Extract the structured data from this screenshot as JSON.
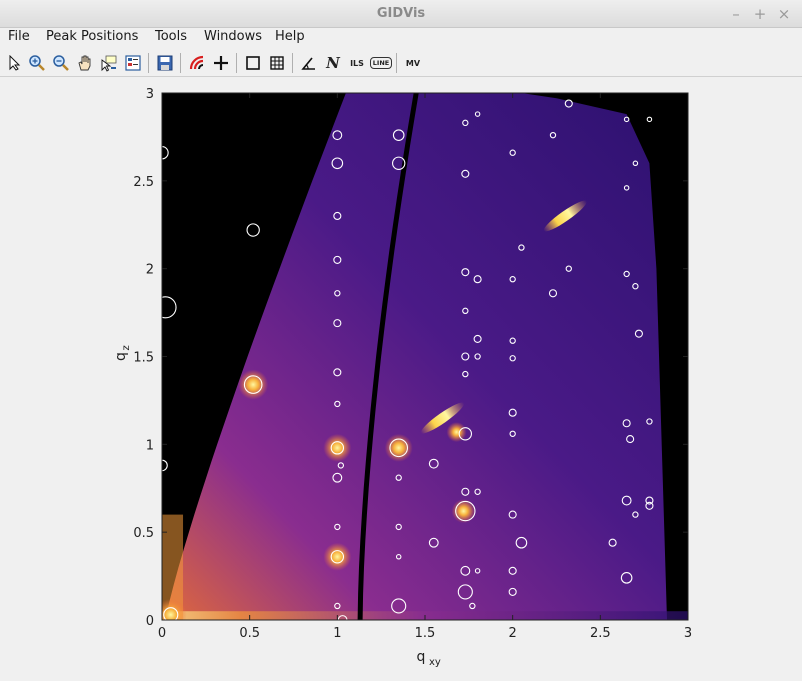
{
  "window": {
    "title": "GIDVis",
    "minimize": "–",
    "maximize": "+",
    "close": "×"
  },
  "menu": [
    "File",
    "Peak Positions",
    "Tools",
    "Windows",
    "Help"
  ],
  "toolbar": [
    {
      "name": "select-tool",
      "icon": "pointer-icon"
    },
    {
      "name": "zoom-in-tool",
      "icon": "zoom-in-icon"
    },
    {
      "name": "zoom-out-tool",
      "icon": "zoom-out-icon"
    },
    {
      "name": "pan-tool",
      "icon": "hand-icon"
    },
    {
      "name": "data-cursor-tool",
      "icon": "data-cursor-icon"
    },
    {
      "name": "legend-tool",
      "icon": "legend-icon"
    },
    {
      "name": "save-tool",
      "icon": "save-icon"
    },
    {
      "name": "ring-tool",
      "icon": "arc-icon"
    },
    {
      "name": "crosshair-tool",
      "icon": "plus-icon"
    },
    {
      "name": "box-tool",
      "icon": "square-icon"
    },
    {
      "name": "grid-tool",
      "icon": "grid-icon"
    },
    {
      "name": "angle-tool",
      "icon": "angle-icon"
    },
    {
      "name": "n-tool",
      "icon": "n-icon",
      "label": "N"
    },
    {
      "name": "ils-tool",
      "icon": "ils-icon",
      "label": "ILS"
    },
    {
      "name": "line-tool",
      "icon": "line-icon",
      "label": "LINE"
    },
    {
      "name": "mv-tool",
      "icon": "mv-icon",
      "label": "MV"
    }
  ],
  "chart_data": {
    "type": "heatmap",
    "xlabel": "q",
    "xlabel_sub": "xy",
    "ylabel": "q",
    "ylabel_sub": "z",
    "xlim": [
      0,
      3
    ],
    "ylim": [
      0,
      3
    ],
    "xticks": [
      "0",
      "0.5",
      "1",
      "1.5",
      "2",
      "2.5",
      "3"
    ],
    "yticks": [
      "0",
      "0.5",
      "1",
      "1.5",
      "2",
      "2.5",
      "3"
    ],
    "colormap": "plasma",
    "colors": {
      "background": "#000000",
      "low": "#2d1170",
      "mid": "#8a2d8f",
      "high": "#e16a3a",
      "peak": "#fff7a0"
    },
    "bright_spots": [
      {
        "x": 0.52,
        "y": 1.34,
        "i": 0.9
      },
      {
        "x": 1.0,
        "y": 0.98,
        "i": 0.8
      },
      {
        "x": 1.0,
        "y": 0.36,
        "i": 0.8
      },
      {
        "x": 1.35,
        "y": 0.98,
        "i": 0.8
      },
      {
        "x": 1.72,
        "y": 0.62,
        "i": 0.6
      },
      {
        "x": 1.68,
        "y": 1.07,
        "i": 0.4
      },
      {
        "x": 0.05,
        "y": 0.03,
        "i": 1.0
      }
    ],
    "streaks": [
      {
        "x": 2.3,
        "y": 2.3,
        "angle": -35
      },
      {
        "x": 1.6,
        "y": 1.15,
        "angle": -35
      }
    ],
    "peak_circles": [
      {
        "x": 0.0,
        "y": 2.66,
        "r": 0.035
      },
      {
        "x": 0.52,
        "y": 2.22,
        "r": 0.035
      },
      {
        "x": 0.02,
        "y": 1.78,
        "r": 0.06
      },
      {
        "x": 0.52,
        "y": 1.34,
        "r": 0.05
      },
      {
        "x": 0.0,
        "y": 0.88,
        "r": 0.03
      },
      {
        "x": 0.05,
        "y": 0.03,
        "r": 0.04
      },
      {
        "x": 1.0,
        "y": 2.76,
        "r": 0.025
      },
      {
        "x": 1.0,
        "y": 2.6,
        "r": 0.03
      },
      {
        "x": 1.0,
        "y": 2.3,
        "r": 0.02
      },
      {
        "x": 1.0,
        "y": 2.05,
        "r": 0.02
      },
      {
        "x": 1.0,
        "y": 1.86,
        "r": 0.015
      },
      {
        "x": 1.0,
        "y": 1.69,
        "r": 0.02
      },
      {
        "x": 1.0,
        "y": 1.41,
        "r": 0.02
      },
      {
        "x": 1.0,
        "y": 1.23,
        "r": 0.015
      },
      {
        "x": 1.0,
        "y": 0.98,
        "r": 0.035
      },
      {
        "x": 1.02,
        "y": 0.88,
        "r": 0.015
      },
      {
        "x": 1.0,
        "y": 0.81,
        "r": 0.025
      },
      {
        "x": 1.0,
        "y": 0.53,
        "r": 0.015
      },
      {
        "x": 1.0,
        "y": 0.36,
        "r": 0.035
      },
      {
        "x": 1.0,
        "y": 0.08,
        "r": 0.015
      },
      {
        "x": 1.03,
        "y": 0.0,
        "r": 0.025
      },
      {
        "x": 1.35,
        "y": 2.76,
        "r": 0.03
      },
      {
        "x": 1.35,
        "y": 2.6,
        "r": 0.035
      },
      {
        "x": 1.35,
        "y": 0.98,
        "r": 0.05
      },
      {
        "x": 1.35,
        "y": 0.81,
        "r": 0.015
      },
      {
        "x": 1.35,
        "y": 0.53,
        "r": 0.015
      },
      {
        "x": 1.35,
        "y": 0.36,
        "r": 0.012
      },
      {
        "x": 1.35,
        "y": 0.08,
        "r": 0.04
      },
      {
        "x": 1.55,
        "y": 0.89,
        "r": 0.025
      },
      {
        "x": 1.55,
        "y": 0.44,
        "r": 0.025
      },
      {
        "x": 1.73,
        "y": 1.06,
        "r": 0.035
      },
      {
        "x": 1.73,
        "y": 0.73,
        "r": 0.02
      },
      {
        "x": 1.73,
        "y": 0.62,
        "r": 0.055
      },
      {
        "x": 1.73,
        "y": 0.28,
        "r": 0.025
      },
      {
        "x": 1.73,
        "y": 0.16,
        "r": 0.04
      },
      {
        "x": 1.77,
        "y": 0.08,
        "r": 0.015
      },
      {
        "x": 1.8,
        "y": 0.73,
        "r": 0.015
      },
      {
        "x": 1.8,
        "y": 0.28,
        "r": 0.012
      },
      {
        "x": 1.73,
        "y": 1.98,
        "r": 0.02
      },
      {
        "x": 1.8,
        "y": 1.94,
        "r": 0.02
      },
      {
        "x": 1.73,
        "y": 1.76,
        "r": 0.015
      },
      {
        "x": 1.8,
        "y": 1.6,
        "r": 0.02
      },
      {
        "x": 1.73,
        "y": 1.5,
        "r": 0.02
      },
      {
        "x": 1.8,
        "y": 1.5,
        "r": 0.015
      },
      {
        "x": 1.73,
        "y": 1.4,
        "r": 0.015
      },
      {
        "x": 1.73,
        "y": 2.54,
        "r": 0.02
      },
      {
        "x": 1.73,
        "y": 2.83,
        "r": 0.015
      },
      {
        "x": 1.8,
        "y": 2.88,
        "r": 0.012
      },
      {
        "x": 2.0,
        "y": 0.6,
        "r": 0.02
      },
      {
        "x": 2.05,
        "y": 0.44,
        "r": 0.03
      },
      {
        "x": 2.0,
        "y": 0.28,
        "r": 0.02
      },
      {
        "x": 2.0,
        "y": 0.16,
        "r": 0.02
      },
      {
        "x": 2.0,
        "y": 1.18,
        "r": 0.02
      },
      {
        "x": 2.0,
        "y": 1.06,
        "r": 0.015
      },
      {
        "x": 2.0,
        "y": 1.49,
        "r": 0.015
      },
      {
        "x": 2.0,
        "y": 1.59,
        "r": 0.015
      },
      {
        "x": 2.0,
        "y": 1.94,
        "r": 0.015
      },
      {
        "x": 2.05,
        "y": 2.12,
        "r": 0.015
      },
      {
        "x": 2.0,
        "y": 2.66,
        "r": 0.015
      },
      {
        "x": 2.23,
        "y": 1.86,
        "r": 0.02
      },
      {
        "x": 2.23,
        "y": 2.76,
        "r": 0.015
      },
      {
        "x": 2.32,
        "y": 2.0,
        "r": 0.015
      },
      {
        "x": 2.32,
        "y": 2.94,
        "r": 0.02
      },
      {
        "x": 2.57,
        "y": 0.44,
        "r": 0.02
      },
      {
        "x": 2.65,
        "y": 0.24,
        "r": 0.03
      },
      {
        "x": 2.65,
        "y": 0.68,
        "r": 0.025
      },
      {
        "x": 2.65,
        "y": 1.12,
        "r": 0.02
      },
      {
        "x": 2.67,
        "y": 1.03,
        "r": 0.02
      },
      {
        "x": 2.7,
        "y": 0.6,
        "r": 0.015
      },
      {
        "x": 2.78,
        "y": 0.68,
        "r": 0.02
      },
      {
        "x": 2.78,
        "y": 0.65,
        "r": 0.02
      },
      {
        "x": 2.72,
        "y": 1.63,
        "r": 0.02
      },
      {
        "x": 2.65,
        "y": 1.97,
        "r": 0.015
      },
      {
        "x": 2.7,
        "y": 1.9,
        "r": 0.015
      },
      {
        "x": 2.65,
        "y": 2.85,
        "r": 0.012
      },
      {
        "x": 2.78,
        "y": 2.85,
        "r": 0.012
      },
      {
        "x": 2.65,
        "y": 2.46,
        "r": 0.012
      },
      {
        "x": 2.7,
        "y": 2.6,
        "r": 0.012
      },
      {
        "x": 2.78,
        "y": 1.13,
        "r": 0.015
      }
    ]
  }
}
